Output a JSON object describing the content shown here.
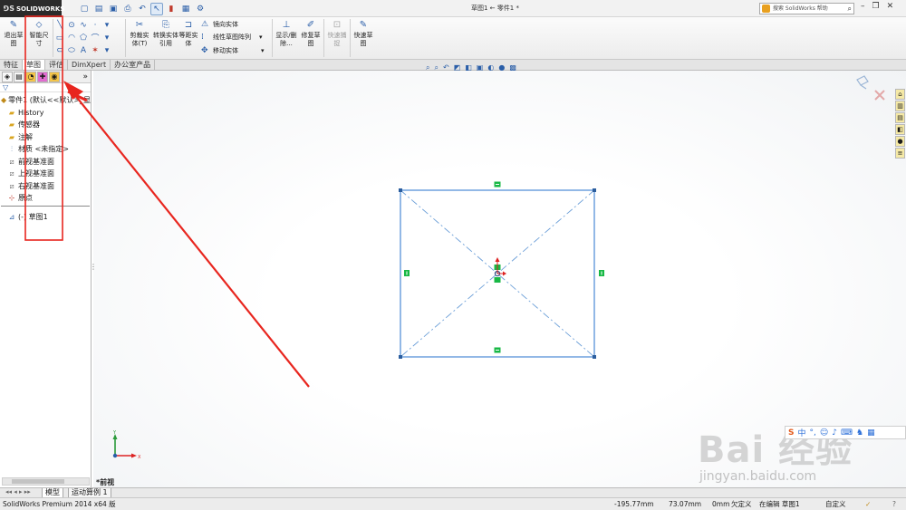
{
  "app": {
    "logo_text": "SOLIDWORKS",
    "window_title": "草图1 ← 零件1 *",
    "search_placeholder": "搜索 SolidWorks 帮助"
  },
  "ribbon": {
    "exit_sketch": "退出草图",
    "smart_dimension": "智能尺寸",
    "trim_entities": "剪裁实体(T)",
    "convert_entities": "转换实体引用",
    "offset_entities": "等距实体",
    "mirror_entities": "镜向实体",
    "linear_pattern": "线性草图阵列",
    "move_entities": "移动实体",
    "display_delete": "显示/删除...",
    "repair_sketch": "修复草图",
    "quick_snaps": "快速捕捉",
    "rapid_sketch": "快速草图"
  },
  "tabs": [
    "特征",
    "草图",
    "评估",
    "DimXpert",
    "办公室产品"
  ],
  "tree": {
    "root": "零件1 (默认<<默认>_显",
    "items": [
      "History",
      "传感器",
      "注解",
      "材质 <未指定>",
      "前视基准面",
      "上视基准面",
      "右视基准面",
      "原点"
    ],
    "sketch": "(-) 草图1"
  },
  "view": {
    "name": "*前视"
  },
  "bottom_tabs": [
    "模型",
    "运动算例 1"
  ],
  "status": {
    "product": "SolidWorks Premium 2014 x64 版",
    "x": "-195.77mm",
    "y": "73.07mm",
    "z": "0mm",
    "define_state": "欠定义",
    "mode": "在编辑 草图1",
    "units": "自定义"
  },
  "watermark": {
    "text": "Bai 经验",
    "url": "jingyan.baidu.com"
  },
  "ime": {
    "label": "中"
  },
  "colors": {
    "sketch_line": "#3a7fd1",
    "annotation": "#e8261f",
    "constraint": "#18b845",
    "logo_bg": "#2b2b2b"
  }
}
